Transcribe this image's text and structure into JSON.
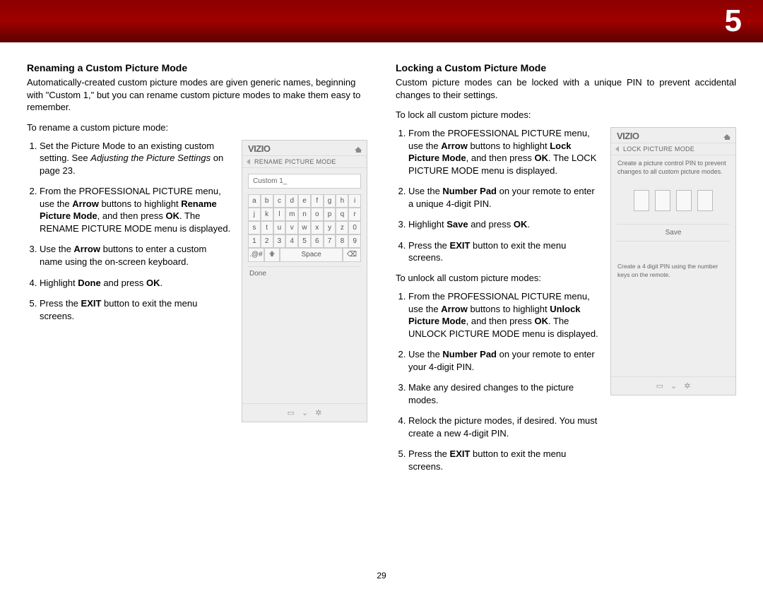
{
  "chapter_number": "5",
  "page_number": "29",
  "left": {
    "heading": "Renaming a Custom Picture Mode",
    "intro": "Automatically-created custom picture modes are given generic names, beginning with \"Custom 1,\" but you can rename custom picture modes to make them easy to remember.",
    "lead": "To rename a custom picture mode:",
    "steps": {
      "s1a": "Set the Picture Mode to an existing custom setting. See ",
      "s1b": "Adjusting the Picture Settings",
      "s1c": " on page 23.",
      "s2a": "From the PROFESSIONAL PICTURE menu, use the ",
      "s2b": "Arrow",
      "s2c": " buttons to highlight ",
      "s2d": "Rename Picture Mode",
      "s2e": ", and then press ",
      "s2f": "OK",
      "s2g": ". The RENAME PICTURE MODE menu is displayed.",
      "s3a": "Use the ",
      "s3b": "Arrow",
      "s3c": " buttons to enter a custom name using the on-screen keyboard.",
      "s4a": "Highlight ",
      "s4b": "Done",
      "s4c": " and press ",
      "s4d": "OK",
      "s4e": ".",
      "s5a": "Press the ",
      "s5b": "EXIT",
      "s5c": " button to exit the menu screens."
    },
    "panel": {
      "brand": "VIZIO",
      "title": "RENAME PICTURE MODE",
      "input_value": "Custom 1_",
      "row1": [
        "a",
        "b",
        "c",
        "d",
        "e",
        "f",
        "g",
        "h",
        "i"
      ],
      "row2": [
        "j",
        "k",
        "l",
        "m",
        "n",
        "o",
        "p",
        "q",
        "r"
      ],
      "row3": [
        "s",
        "t",
        "u",
        "v",
        "w",
        "x",
        "y",
        "z",
        "0"
      ],
      "row4": [
        "1",
        "2",
        "3",
        "4",
        "5",
        "6",
        "7",
        "8",
        "9"
      ],
      "sym": ".@#",
      "space": "Space",
      "done": "Done"
    }
  },
  "right": {
    "heading": "Locking a Custom Picture Mode",
    "intro": "Custom picture modes can be locked with a unique PIN to prevent accidental changes to their settings.",
    "lead1": "To lock all custom picture modes:",
    "lock_steps": {
      "s1a": "From the PROFESSIONAL PICTURE menu, use the ",
      "s1b": "Arrow",
      "s1c": " buttons to highlight ",
      "s1d": "Lock Picture Mode",
      "s1e": ", and then press ",
      "s1f": "OK",
      "s1g": ". The LOCK PICTURE MODE menu is displayed.",
      "s2a": "Use the ",
      "s2b": "Number Pad",
      "s2c": " on your remote to enter a unique 4-digit PIN.",
      "s3a": "Highlight ",
      "s3b": "Save",
      "s3c": " and press ",
      "s3d": "OK",
      "s3e": ".",
      "s4a": "Press the ",
      "s4b": "EXIT",
      "s4c": " button to exit the menu screens."
    },
    "lead2": "To unlock all custom picture modes:",
    "unlock_steps": {
      "s1a": "From the PROFESSIONAL PICTURE menu, use the ",
      "s1b": "Arrow",
      "s1c": " buttons to highlight ",
      "s1d": "Unlock Picture Mode",
      "s1e": ", and then press ",
      "s1f": "OK",
      "s1g": ". The UNLOCK PICTURE MODE menu is displayed.",
      "s2a": "Use the ",
      "s2b": "Number Pad",
      "s2c": " on your remote to enter your 4-digit PIN.",
      "s3": "Make any desired changes to the picture modes.",
      "s4": "Relock the picture modes, if desired. You must create a new 4-digit PIN.",
      "s5a": "Press the ",
      "s5b": "EXIT",
      "s5c": " button to exit the menu screens."
    },
    "panel": {
      "brand": "VIZIO",
      "title": "LOCK PICTURE MODE",
      "desc": "Create a picture control PIN to prevent changes to all custom picture modes.",
      "save": "Save",
      "note": "Create a 4 digit PIN using the number keys on the remote."
    }
  }
}
